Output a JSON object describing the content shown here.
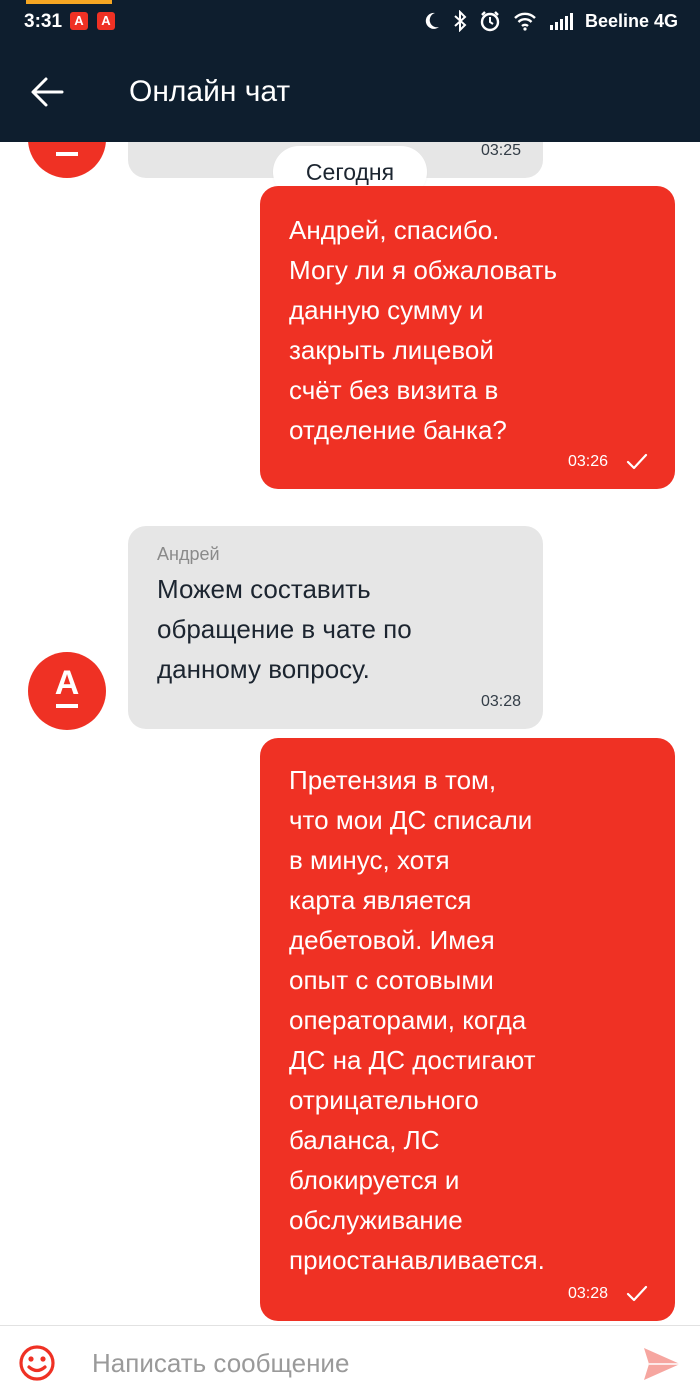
{
  "status_bar": {
    "time": "3:31",
    "app_icon_letter": "А",
    "carrier": "Beeline 4G"
  },
  "header": {
    "title": "Онлайн чат"
  },
  "chat": {
    "date_separator": "Сегодня",
    "messages": [
      {
        "direction": "incoming",
        "time": "03:25",
        "avatar_letter": "А"
      },
      {
        "direction": "outgoing",
        "text": "Андрей, спасибо.\nМогу ли я обжаловать\nданную сумму и\nзакрыть лицевой\nсчёт без визита в\nотделение банка?",
        "time": "03:26",
        "read": true
      },
      {
        "direction": "incoming",
        "author": "Андрей",
        "text": "Можем составить\nобращение в чате по\nданному вопросу.",
        "time": "03:28",
        "avatar_letter": "А"
      },
      {
        "direction": "outgoing",
        "text": "Претензия в том,\nчто мои ДС списали\nв минус, хотя\nкарта является\nдебетовой. Имея\nопыт с сотовыми\nоператорами, когда\nДС на ДС достигают\nотрицательного\nбаланса, ЛС\nблокируется и\nобслуживание\nприостанавливается.",
        "time": "03:28",
        "read": true
      }
    ]
  },
  "composer": {
    "placeholder": "Написать сообщение"
  },
  "colors": {
    "brand_red": "#ef3124",
    "header_bg": "#0e1e2e",
    "incoming_bubble": "#e6e6e6"
  },
  "icons": {
    "back": "arrow-left-icon",
    "emoji": "smiley-icon",
    "send": "paper-plane-icon",
    "read": "checkmark-icon"
  }
}
